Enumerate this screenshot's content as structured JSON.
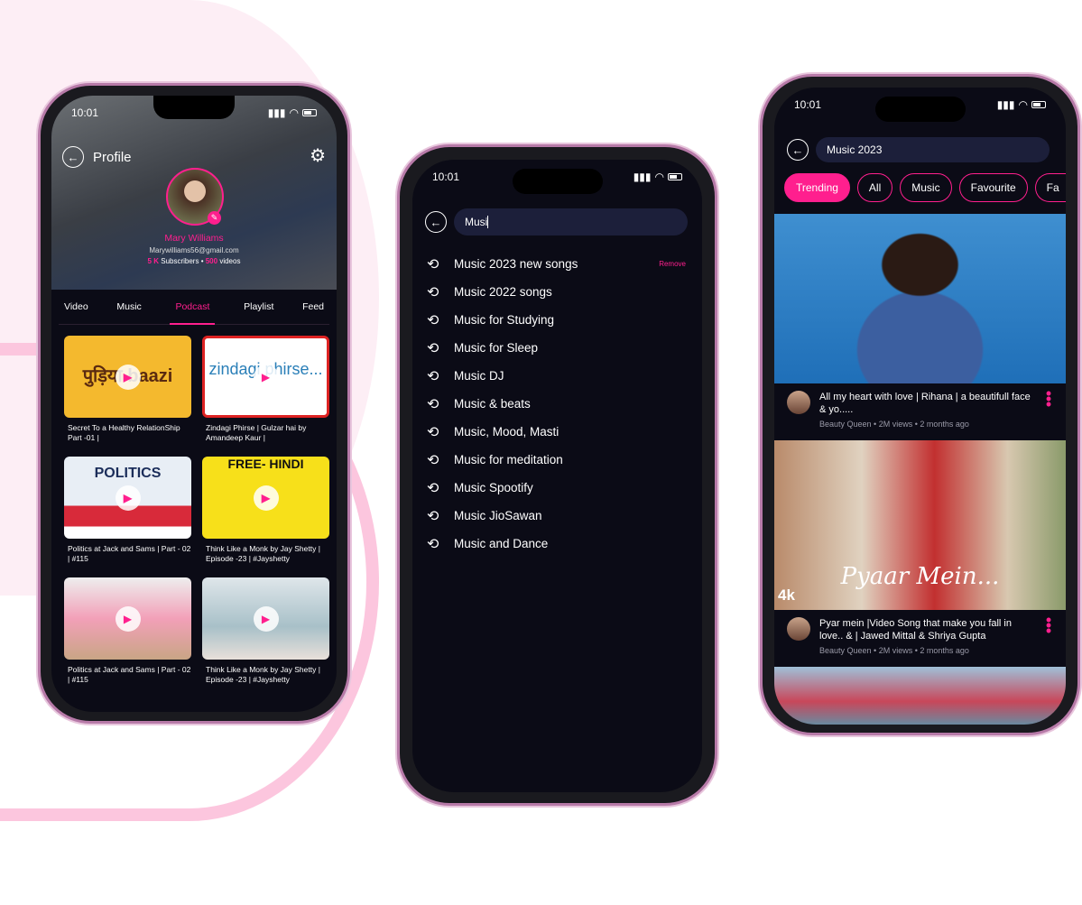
{
  "status": {
    "time": "10:01"
  },
  "profile": {
    "title": "Profile",
    "name": "Mary Williams",
    "email": "Marywilliams56@gmail.com",
    "subscribers": "5 K",
    "subscribers_label": "Subscribers",
    "videos": "500",
    "videos_label": "videos",
    "tabs": [
      "Video",
      "Music",
      "Podcast",
      "Playlist",
      "Feed"
    ],
    "active_tab": "Podcast",
    "cards": [
      {
        "title": "Secret To a Healthy RelationShip Part -01 |",
        "thumb_text": "पुड़िया baazi"
      },
      {
        "title": "Zindagi Phirse | Gulzar hai by Amandeep Kaur |",
        "thumb_text": "zindagi phirse..."
      },
      {
        "title": "Politics at Jack and Sams | Part - 02 | #115",
        "thumb_text": "POLITICS"
      },
      {
        "title": "Think Like a Monk by Jay Shetty | Episode -23 | #Jayshetty",
        "thumb_text": "FREE- HINDI"
      },
      {
        "title": "Politics at Jack and Sams | Part - 02 | #115",
        "thumb_text": ""
      },
      {
        "title": "Think Like a Monk by Jay Shetty | Episode -23 | #Jayshetty",
        "thumb_text": ""
      }
    ]
  },
  "search": {
    "query": "Musi",
    "remove_label": "Remove",
    "history": [
      "Music 2023 new songs",
      "Music 2022 songs",
      "Music for Studying",
      "Music for Sleep",
      "Music DJ",
      "Music & beats",
      "Music, Mood, Masti",
      "Music for meditation",
      "Music Spootify",
      "Music JioSawan",
      "Music and Dance"
    ]
  },
  "results": {
    "query": "Music 2023",
    "chips": [
      "Trending",
      "All",
      "Music",
      "Favourite",
      "Fa"
    ],
    "active_chip": "Trending",
    "videos": [
      {
        "title": "All my heart with love | Rihana | a beautifull face & yo.....",
        "channel": "Beauty Queen",
        "views": "2M views",
        "age": "2 months ago"
      },
      {
        "title": "Pyar mein |Video Song that make you fall in love.. & | Jawed Mittal & Shriya Gupta",
        "channel": "Beauty Queen",
        "views": "2M views",
        "age": "2 months ago",
        "thumb_text": "Pyaar Mein...",
        "badge": "4k"
      }
    ]
  },
  "colors": {
    "accent": "#ff1f8e",
    "background": "#0b0b16"
  }
}
